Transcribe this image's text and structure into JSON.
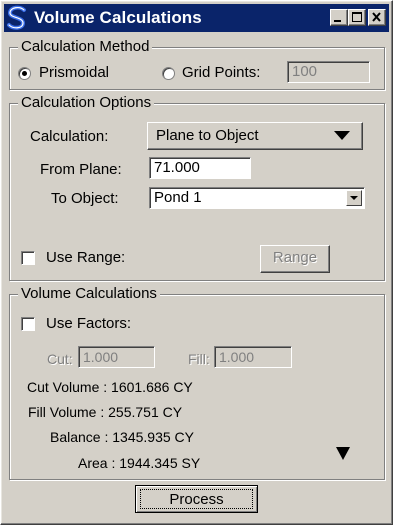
{
  "window": {
    "title": "Volume Calculations",
    "app_icon": "geopak-s-icon",
    "controls": [
      "minimize-icon",
      "maximize-icon",
      "close-icon"
    ]
  },
  "calculation_method": {
    "legend": "Calculation Method",
    "prismoidal_label": "Prismoidal",
    "prismoidal_selected": true,
    "grid_points_label": "Grid Points:",
    "grid_points_value": "100"
  },
  "calculation_options": {
    "legend": "Calculation Options",
    "calculation_label": "Calculation:",
    "calculation_value": "Plane to Object",
    "from_plane_label": "From Plane:",
    "from_plane_value": "71.000",
    "to_object_label": "To Object:",
    "to_object_value": "Pond 1",
    "use_range_label": "Use Range:",
    "use_range_checked": false,
    "range_button": "Range"
  },
  "volume_calculations": {
    "legend": "Volume Calculations",
    "use_factors_label": "Use Factors:",
    "use_factors_checked": false,
    "cut_label": "Cut:",
    "cut_value": "1.000",
    "fill_label": "Fill:",
    "fill_value": "1.000",
    "cut_volume": "Cut Volume : 1601.686 CY",
    "fill_volume": "Fill Volume : 255.751 CY",
    "balance": "Balance : 1345.935 CY",
    "area": "Area : 1944.345 SY",
    "expand_icon": "triangle-down-icon"
  },
  "process_button": "Process"
}
